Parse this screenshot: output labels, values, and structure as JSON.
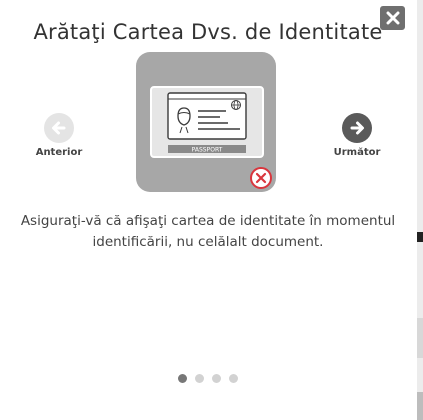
{
  "modal": {
    "title": "Arătaţi Cartea Dvs. de Identitate",
    "instruction": "Asiguraţi-vă că afişaţi cartea de identitate în momentul identificării, nu celălalt document.",
    "close_icon": "close-icon"
  },
  "illustration": {
    "document_label": "PASSPORT",
    "icons": [
      "id-card-icon",
      "error-x-icon"
    ],
    "tile_color": "#a7a7a7",
    "error_color": "#d9363e"
  },
  "navigation": {
    "prev_label": "Anterior",
    "next_label": "Următor",
    "prev_icon": "arrow-left-icon",
    "next_icon": "arrow-right-icon"
  },
  "pagination": {
    "total": 4,
    "active": 1
  }
}
